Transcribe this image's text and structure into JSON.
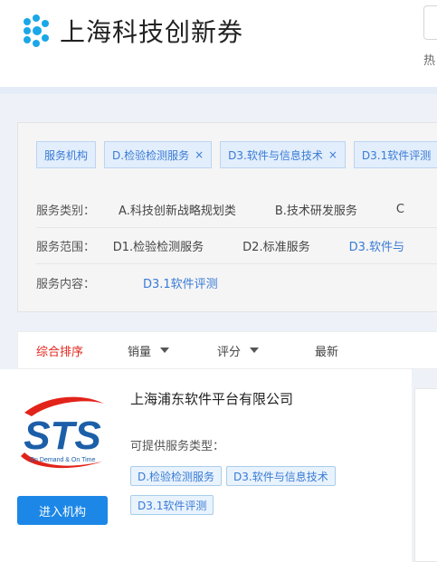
{
  "header": {
    "brand_name": "上海科技创新券",
    "hot_label": "热"
  },
  "filters": {
    "selected_chips": [
      {
        "label": "服务机构",
        "removable": false
      },
      {
        "label": "D.检验检测服务",
        "removable": true
      },
      {
        "label": "D3.软件与信息技术",
        "removable": true
      },
      {
        "label": "D3.1软件评测",
        "removable": true
      }
    ],
    "remove_symbol": "×",
    "rows": [
      {
        "label": "服务类别：",
        "options": [
          "A.科技创新战略规划类",
          "B.技术研发服务",
          "C"
        ]
      },
      {
        "label": "服务范围：",
        "options": [
          "D1.检验检测服务",
          "D2.标准服务",
          "D3.软件与"
        ]
      },
      {
        "label": "服务内容：",
        "options": [
          "D3.1软件评测"
        ]
      }
    ]
  },
  "sort": {
    "items": [
      {
        "label": "综合排序",
        "active": true,
        "has_caret": false
      },
      {
        "label": "销量",
        "active": false,
        "has_caret": true
      },
      {
        "label": "评分",
        "active": false,
        "has_caret": true
      },
      {
        "label": "最新",
        "active": false,
        "has_caret": false
      }
    ]
  },
  "card": {
    "org_name": "上海浦东软件平台有限公司",
    "logo_text": "STS",
    "logo_tagline": "On Demand & On Time",
    "services_title": "可提供服务类型：",
    "tags": [
      "D.检验检测服务",
      "D3.软件与信息技术",
      "D3.1软件评测"
    ],
    "enter_label": "进入机构"
  },
  "colors": {
    "accent_blue": "#1c87e6",
    "active_red": "#e2231a",
    "chip_text": "#3a7bd5"
  }
}
